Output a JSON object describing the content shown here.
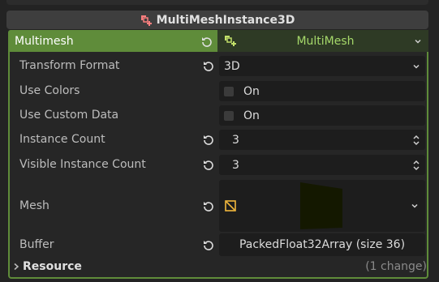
{
  "header": {
    "title": "MultiMeshInstance3D",
    "icon": "multimeshinstance3d-icon"
  },
  "multimesh": {
    "label": "Multimesh",
    "value": "MultiMesh",
    "icon": "multimesh-icon"
  },
  "properties": {
    "transform_format": {
      "label": "Transform Format",
      "value": "3D"
    },
    "use_colors": {
      "label": "Use Colors",
      "checkbox_text": "On",
      "checked": false
    },
    "use_custom_data": {
      "label": "Use Custom Data",
      "checkbox_text": "On",
      "checked": false
    },
    "instance_count": {
      "label": "Instance Count",
      "value": "3"
    },
    "visible_instance_count": {
      "label": "Visible Instance Count",
      "value": "3"
    },
    "mesh": {
      "label": "Mesh",
      "icon": "mesh-icon"
    },
    "buffer": {
      "label": "Buffer",
      "value": "PackedFloat32Array (size 36)"
    }
  },
  "resource": {
    "label": "Resource",
    "changes": "(1 change)"
  },
  "colors": {
    "accent_green": "#5f8c3a",
    "text_green": "#a5d86a",
    "mesh_icon": "#f2b83c"
  }
}
